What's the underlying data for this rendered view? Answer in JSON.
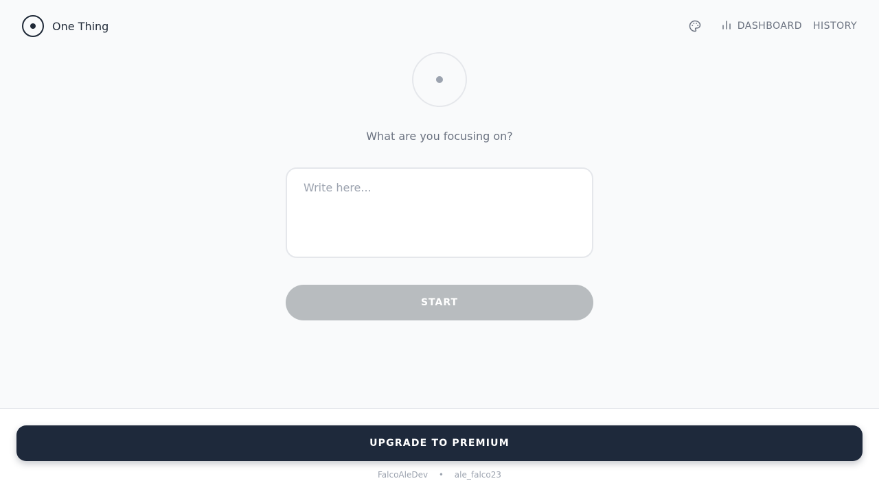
{
  "app": {
    "name": "One Thing",
    "logo_icon": "target-dot-icon"
  },
  "nav": {
    "theme_icon": "palette-icon",
    "dashboard_icon": "bar-chart-icon",
    "dashboard_label": "DASHBOARD",
    "history_label": "HISTORY"
  },
  "focus": {
    "indicator_icon": "focus-dot-icon",
    "question": "What are you focusing on?",
    "input_placeholder": "Write here...",
    "input_value": "",
    "start_label": "START"
  },
  "footer": {
    "premium_label": "UPGRADE TO PREMIUM",
    "credit_1": "FalcoAleDev",
    "separator": "•",
    "credit_2": "ale_falco23"
  },
  "colors": {
    "background": "#f9fafb",
    "primary_dark": "#1e293b",
    "button_disabled": "#b8bcbf",
    "muted_text": "#6b7280",
    "border": "#e5e7eb"
  }
}
